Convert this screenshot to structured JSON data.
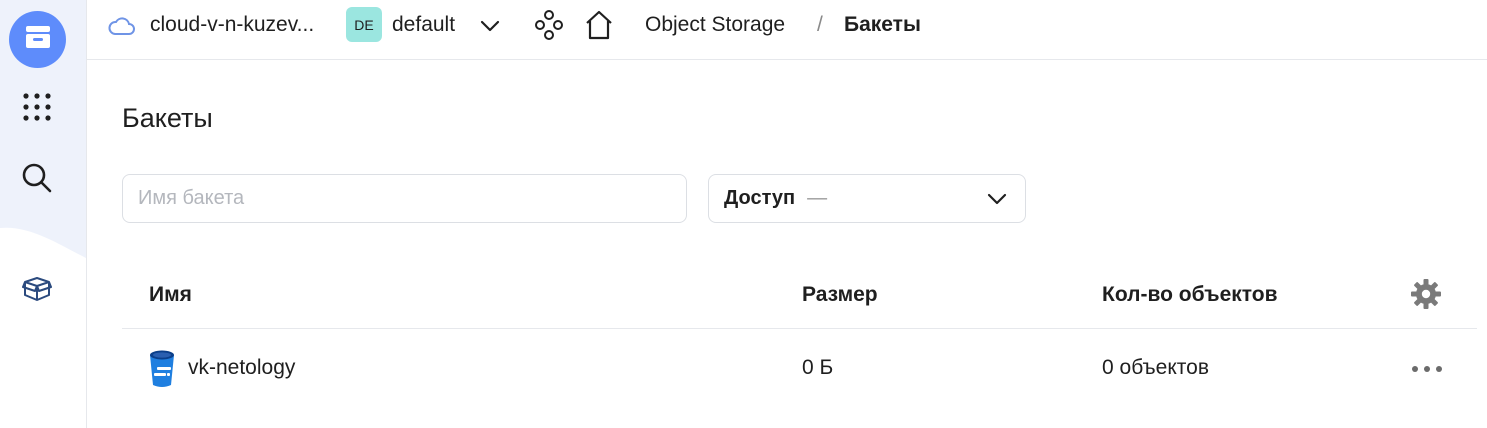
{
  "colors": {
    "accent": "#5e8cfb",
    "folder_badge_bg": "#9be6e0",
    "bucket_icon": "#1f7fe0",
    "border": "#dcdfe4"
  },
  "rail": {
    "icons": [
      "object-storage-icon",
      "all-services-grid-icon",
      "search-icon",
      "marketplace-box-icon"
    ]
  },
  "header": {
    "cloud_name": "cloud-v-n-kuzev...",
    "folder_badge": "DE",
    "folder_name": "default",
    "breadcrumb": {
      "service": "Object Storage",
      "separator": "/",
      "current": "Бакеты"
    }
  },
  "page": {
    "title": "Бакеты"
  },
  "filters": {
    "search_placeholder": "Имя бакета",
    "search_value": "",
    "access_label": "Доступ",
    "access_value": "—"
  },
  "table": {
    "columns": {
      "name": "Имя",
      "size": "Размер",
      "count": "Кол-во объектов"
    },
    "rows": [
      {
        "name": "vk-netology",
        "size": "0 Б",
        "count": "0 объектов"
      }
    ]
  }
}
